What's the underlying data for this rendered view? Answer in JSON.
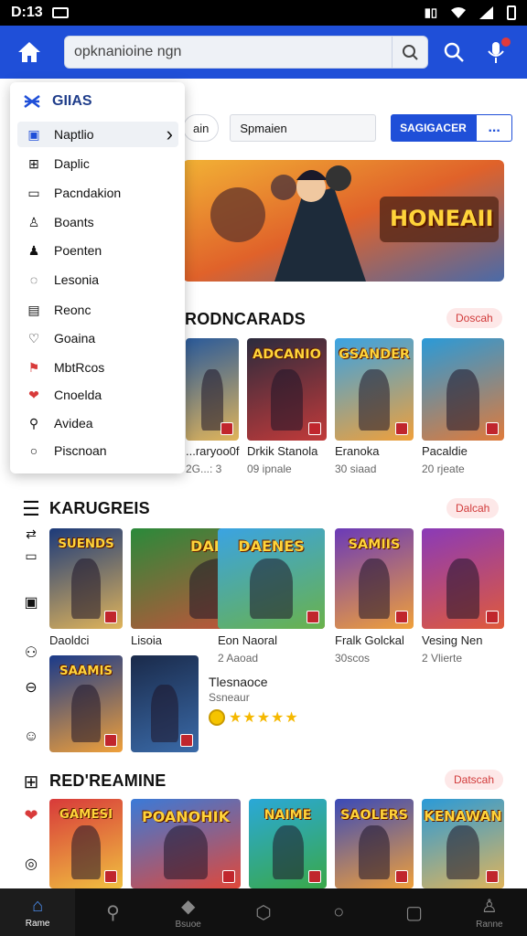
{
  "status": {
    "time": "D:13",
    "battery_icon": "battery-icon"
  },
  "search": {
    "value": "opknanioine ngn"
  },
  "filters": {
    "chip": "ain",
    "select_value": "Spmaien",
    "search_button": "SAGIGACER",
    "more_button": "..."
  },
  "banner": {
    "title": "HONEAII"
  },
  "drawer": {
    "title": "GIIAS",
    "items": [
      {
        "label": "Naptlio",
        "icon": "box-icon",
        "active": true
      },
      {
        "label": "Daplic",
        "icon": "grid-icon"
      },
      {
        "label": "Pacndakion",
        "icon": "chat-icon"
      },
      {
        "label": "Boants",
        "icon": "bag-icon"
      },
      {
        "label": "Poenten",
        "icon": "person-icon"
      },
      {
        "label": "Lesonia",
        "icon": "bubble-icon"
      },
      {
        "label": "Reonc",
        "icon": "doc-icon"
      },
      {
        "label": "Goaina",
        "icon": "heart-outline-icon"
      },
      {
        "label": "MbtRcos",
        "icon": "game-icon"
      },
      {
        "label": "Cnoelda",
        "icon": "heart-icon"
      },
      {
        "label": "Avidea",
        "icon": "search-icon"
      },
      {
        "label": "Piscnoan",
        "icon": "magnifier-icon"
      }
    ]
  },
  "sections": [
    {
      "title": "RODNCARADS",
      "pill": "Doscah",
      "tiles": [
        {
          "caption": "...raryoo0f",
          "sub": "2G...: 3",
          "label": "",
          "c1": "#2a5a9a",
          "c2": "#e0b45a"
        },
        {
          "caption": "Drkik Stanola",
          "sub": "09 ipnale",
          "label": "ADCANIO",
          "c1": "#2b2b3d",
          "c2": "#c23a3a"
        },
        {
          "caption": "Eranoka",
          "sub": "30 siaad",
          "label": "GSANDER",
          "c1": "#3aa3e3",
          "c2": "#f0a03a"
        },
        {
          "caption": "Pacaldie",
          "sub": "20 rjeate",
          "label": "",
          "c1": "#2a9ad8",
          "c2": "#e07a3a"
        }
      ]
    },
    {
      "title": "KARUGREIS",
      "pill": "Dalcah",
      "tiles": [
        {
          "caption": "Daoldci",
          "sub": "",
          "label": "SUENDS",
          "c1": "#1c3a7a",
          "c2": "#e0b45a"
        },
        {
          "caption": "Lisoia",
          "sub": "",
          "label": "DANUSAI",
          "c1": "#2a8a3a",
          "c2": "#e0483a"
        },
        {
          "caption": "Eon Naoral",
          "sub": "2 Aaoad",
          "label": "DAENES",
          "c1": "#3aa3e3",
          "c2": "#6ab24a"
        },
        {
          "caption": "Fralk Golckal",
          "sub": "30scos",
          "label": "SAMIIS",
          "c1": "#6a3ab8",
          "c2": "#f0a03a"
        },
        {
          "caption": "Vesing Nen",
          "sub": "2 Vlierte",
          "label": "",
          "c1": "#8a3ab8",
          "c2": "#e05a3a"
        }
      ],
      "extra": [
        {
          "label": "SAAMIS",
          "c1": "#1a3a8a",
          "c2": "#f0a03a"
        },
        {
          "label": "",
          "c1": "#1a2a4a",
          "c2": "#3a6aa8"
        }
      ],
      "extra_title": "Tlesnaoce",
      "extra_sub": "Ssneaur",
      "rating": "★★★★★"
    },
    {
      "title": "RED'REAMINE",
      "pill": "Datscah",
      "tiles": [
        {
          "label": "GAMESI",
          "c1": "#d83a3a",
          "c2": "#f0c040"
        },
        {
          "label": "POANOHIK",
          "c1": "#3a7ad8",
          "c2": "#e0483a"
        },
        {
          "label": "NAIME",
          "c1": "#2aa8d8",
          "c2": "#3aa848"
        },
        {
          "label": "SAOLERS",
          "c1": "#3a4ab8",
          "c2": "#f0a03a"
        },
        {
          "label": "KENAWAN",
          "c1": "#2a9ad8",
          "c2": "#e0b45a"
        }
      ]
    }
  ],
  "bottom_nav": [
    {
      "label": "Rame",
      "icon": "home-icon",
      "active": true
    },
    {
      "label": "",
      "icon": "search-icon"
    },
    {
      "label": "Bsuoe",
      "icon": "layers-icon"
    },
    {
      "label": "",
      "icon": "shield-icon"
    },
    {
      "label": "",
      "icon": "magnifier-icon"
    },
    {
      "label": "",
      "icon": "square-icon"
    },
    {
      "label": "Ranne",
      "icon": "user-icon"
    }
  ],
  "colors": {
    "primary": "#1f4fd8",
    "pill_bg": "#fde8e8",
    "pill_text": "#d13a3a"
  }
}
